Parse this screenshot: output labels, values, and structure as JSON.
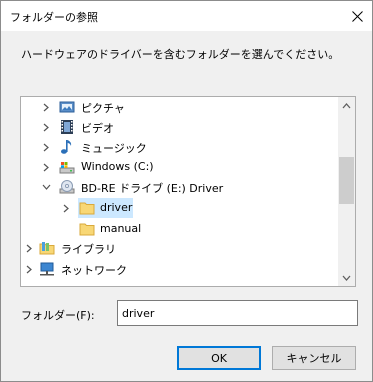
{
  "window": {
    "title": "フォルダーの参照"
  },
  "instruction": "ハードウェアのドライバーを含むフォルダーを選んでください。",
  "tree": {
    "items": [
      {
        "label": "ピクチャ",
        "icon": "pictures-folder-icon",
        "expand": "collapsed"
      },
      {
        "label": "ビデオ",
        "icon": "videos-folder-icon",
        "expand": "collapsed"
      },
      {
        "label": "ミュージック",
        "icon": "music-folder-icon",
        "expand": "collapsed"
      },
      {
        "label": "Windows (C:)",
        "icon": "drive-icon",
        "expand": "collapsed"
      },
      {
        "label": "BD-RE ドライブ (E:) Driver",
        "icon": "disc-drive-icon",
        "expand": "expanded"
      },
      {
        "label": "driver",
        "icon": "folder-icon",
        "expand": "collapsed",
        "selected": true
      },
      {
        "label": "manual",
        "icon": "folder-icon",
        "expand": "none"
      },
      {
        "label": "ライブラリ",
        "icon": "libraries-icon",
        "expand": "collapsed"
      },
      {
        "label": "ネットワーク",
        "icon": "network-icon",
        "expand": "collapsed"
      }
    ]
  },
  "folder_field": {
    "label": "フォルダー(F):",
    "value": "driver"
  },
  "buttons": {
    "ok": "OK",
    "cancel": "キャンセル"
  },
  "colors": {
    "selection": "#cce8ff",
    "focus": "#0078d7"
  }
}
